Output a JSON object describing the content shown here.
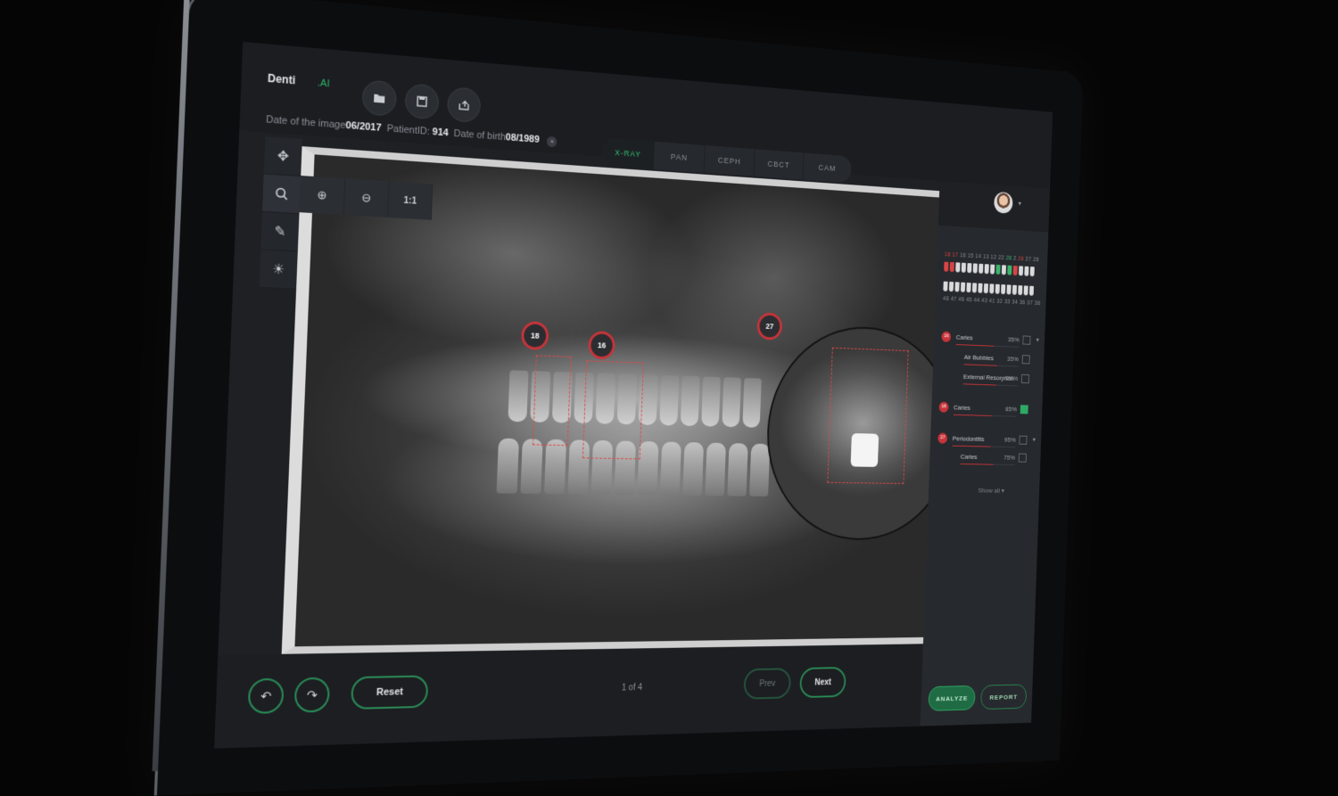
{
  "app": {
    "logo": "Denti",
    "logo_suffix": ".AI"
  },
  "toolbar": {
    "icons": [
      "folder-icon",
      "save-icon",
      "share-icon"
    ]
  },
  "meta": {
    "date_label": "Date of the image",
    "date_value": "06/2017",
    "patient_label": "PatientID:",
    "patient_value": "914",
    "dob_label": "Date of birth",
    "dob_value": "08/1989",
    "clear": "×"
  },
  "tabs": [
    {
      "label": "X-RAY",
      "active": true
    },
    {
      "label": "PAN",
      "active": false
    },
    {
      "label": "CEPH",
      "active": false
    },
    {
      "label": "CBCT",
      "active": false
    },
    {
      "label": "CAM",
      "active": false
    }
  ],
  "left_tools": [
    "move-icon",
    "search-icon",
    "pencil-icon",
    "brightness-icon"
  ],
  "zoom": {
    "zoom_in": "⊕",
    "zoom_out": "⊖",
    "reset_label": "1:1"
  },
  "xray_pins": [
    "18",
    "16",
    "27"
  ],
  "tooth_chart": {
    "upper_numbers": [
      "18",
      "17",
      "16",
      "15",
      "14",
      "13",
      "12",
      "22",
      "28",
      "2",
      "26",
      "27",
      "28"
    ],
    "lower_numbers": [
      "48",
      "47",
      "46",
      "45",
      "44",
      "43",
      "41",
      "32",
      "33",
      "34",
      "36",
      "37",
      "38"
    ]
  },
  "findings": [
    {
      "tooth": "16",
      "name": "Caries",
      "pct": "35%",
      "checked": false,
      "expand": true
    },
    {
      "tooth": "",
      "name": "Air Bubbles",
      "pct": "35%",
      "checked": false,
      "sub": true
    },
    {
      "tooth": "",
      "name": "External Resorption",
      "pct": "20%",
      "checked": false,
      "sub": true
    },
    {
      "tooth": "18",
      "name": "Caries",
      "pct": "85%",
      "checked": true
    },
    {
      "tooth": "27",
      "name": "Periodontitis",
      "pct": "95%",
      "checked": false,
      "expand": true
    },
    {
      "tooth": "",
      "name": "Caries",
      "pct": "75%",
      "checked": false,
      "sub": true
    }
  ],
  "show_all": "Show all",
  "actions": {
    "analyze": "ANALYZE",
    "report": "REPORT"
  },
  "bottom": {
    "undo_icon": "undo-icon",
    "redo_icon": "redo-icon",
    "reset": "Reset",
    "page_info": "1 of 4",
    "prev": "Prev",
    "next": "Next"
  },
  "colors": {
    "accent_green": "#2fb36a",
    "alert_red": "#c7343a",
    "panel_bg": "#26292d"
  }
}
